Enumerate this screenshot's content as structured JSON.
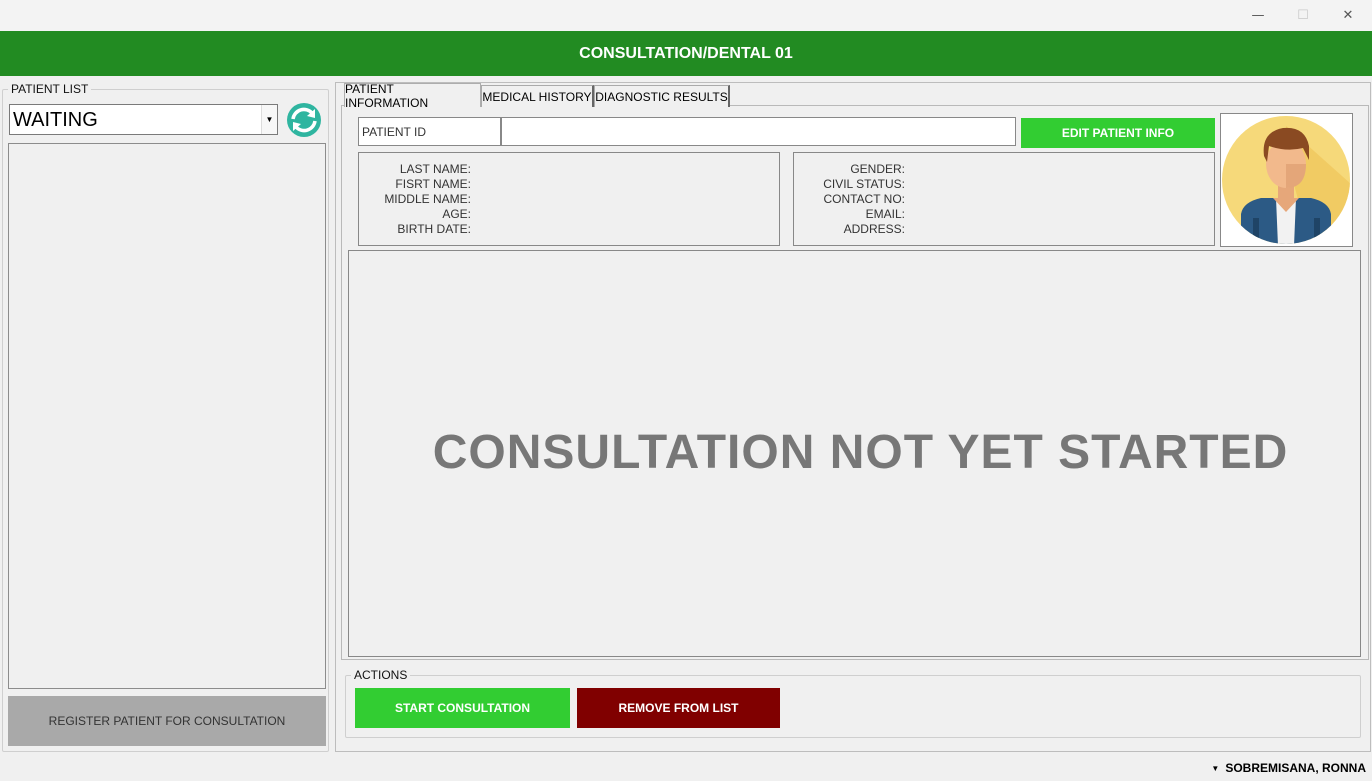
{
  "window": {
    "controls": {
      "minimize": "—",
      "maximize": "☐",
      "close": "✕"
    }
  },
  "header": {
    "title": "CONSULTATION/DENTAL 01"
  },
  "sidebar": {
    "group_label": "PATIENT LIST",
    "filter": {
      "selected": "WAITING",
      "arrow_icon": "chevron-down-icon"
    },
    "refresh_icon": "refresh-icon",
    "register_button": "REGISTER PATIENT FOR CONSULTATION"
  },
  "tabs": [
    {
      "label": "PATIENT INFORMATION",
      "active": true
    },
    {
      "label": "MEDICAL HISTORY",
      "active": false
    },
    {
      "label": "DIAGNOSTIC RESULTS",
      "active": false
    }
  ],
  "patient": {
    "id_label": "PATIENT ID",
    "id_value": "",
    "edit_button": "EDIT PATIENT INFO",
    "left_labels": [
      "LAST NAME:",
      "FISRT NAME:",
      "MIDDLE NAME:",
      "AGE:",
      "BIRTH DATE:"
    ],
    "right_labels": [
      "GENDER:",
      "CIVIL STATUS:",
      "CONTACT NO:",
      "EMAIL:",
      "ADDRESS:"
    ]
  },
  "banner": {
    "text": "CONSULTATION NOT YET STARTED"
  },
  "actions": {
    "group_label": "ACTIONS",
    "start_button": "START CONSULTATION",
    "remove_button": "REMOVE FROM LIST"
  },
  "status": {
    "user": "SOBREMISANA, RONNA"
  },
  "colors": {
    "header_green": "#228b22",
    "button_green": "#32cd32",
    "remove_red": "#800000",
    "register_gray": "#a9a9a9"
  }
}
